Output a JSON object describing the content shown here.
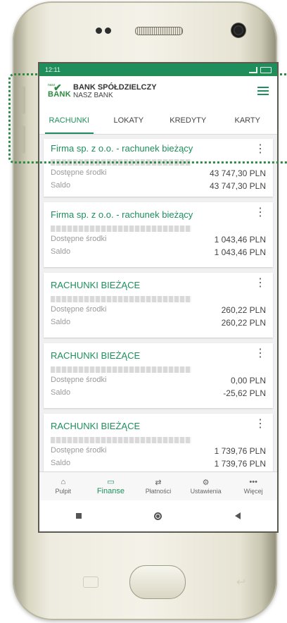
{
  "status_bar": {
    "time": "12:11"
  },
  "header": {
    "logo_small": "nasz",
    "logo_bank": "BANK",
    "brand_name": "BANK SPÓŁDZIELCZY",
    "brand_sub": "NASZ BANK"
  },
  "tabs": [
    {
      "label": "RACHUNKI",
      "active": true
    },
    {
      "label": "LOKATY"
    },
    {
      "label": "KREDYTY"
    },
    {
      "label": "KARTY"
    }
  ],
  "accounts": [
    {
      "title": "Firma sp. z o.o. - rachunek bieżący",
      "available_label": "Dostępne środki",
      "available": "43 747,30 PLN",
      "balance_label": "Saldo",
      "balance": "43 747,30 PLN"
    },
    {
      "title": "Firma sp. z o.o. - rachunek bieżący",
      "available_label": "Dostępne środki",
      "available": "1 043,46 PLN",
      "balance_label": "Saldo",
      "balance": "1 043,46 PLN"
    },
    {
      "title": "RACHUNKI BIEŻĄCE",
      "available_label": "Dostępne środki",
      "available": "260,22 PLN",
      "balance_label": "Saldo",
      "balance": "260,22 PLN"
    },
    {
      "title": "RACHUNKI BIEŻĄCE",
      "available_label": "Dostępne środki",
      "available": "0,00 PLN",
      "balance_label": "Saldo",
      "balance": "-25,62 PLN"
    },
    {
      "title": "RACHUNKI BIEŻĄCE",
      "available_label": "Dostępne środki",
      "available": "1 739,76 PLN",
      "balance_label": "Saldo",
      "balance": "1 739,76 PLN"
    }
  ],
  "bottom_nav": [
    {
      "label": "Pulpit",
      "icon": "home-icon"
    },
    {
      "label": "Finanse",
      "icon": "wallet-icon",
      "active": true
    },
    {
      "label": "Płatności",
      "icon": "transfer-icon"
    },
    {
      "label": "Ustawienia",
      "icon": "gear-icon"
    },
    {
      "label": "Więcej",
      "icon": "more-icon"
    }
  ],
  "colors": {
    "brand_green": "#1e8f5c",
    "highlight_frame": "#2c8a45"
  }
}
